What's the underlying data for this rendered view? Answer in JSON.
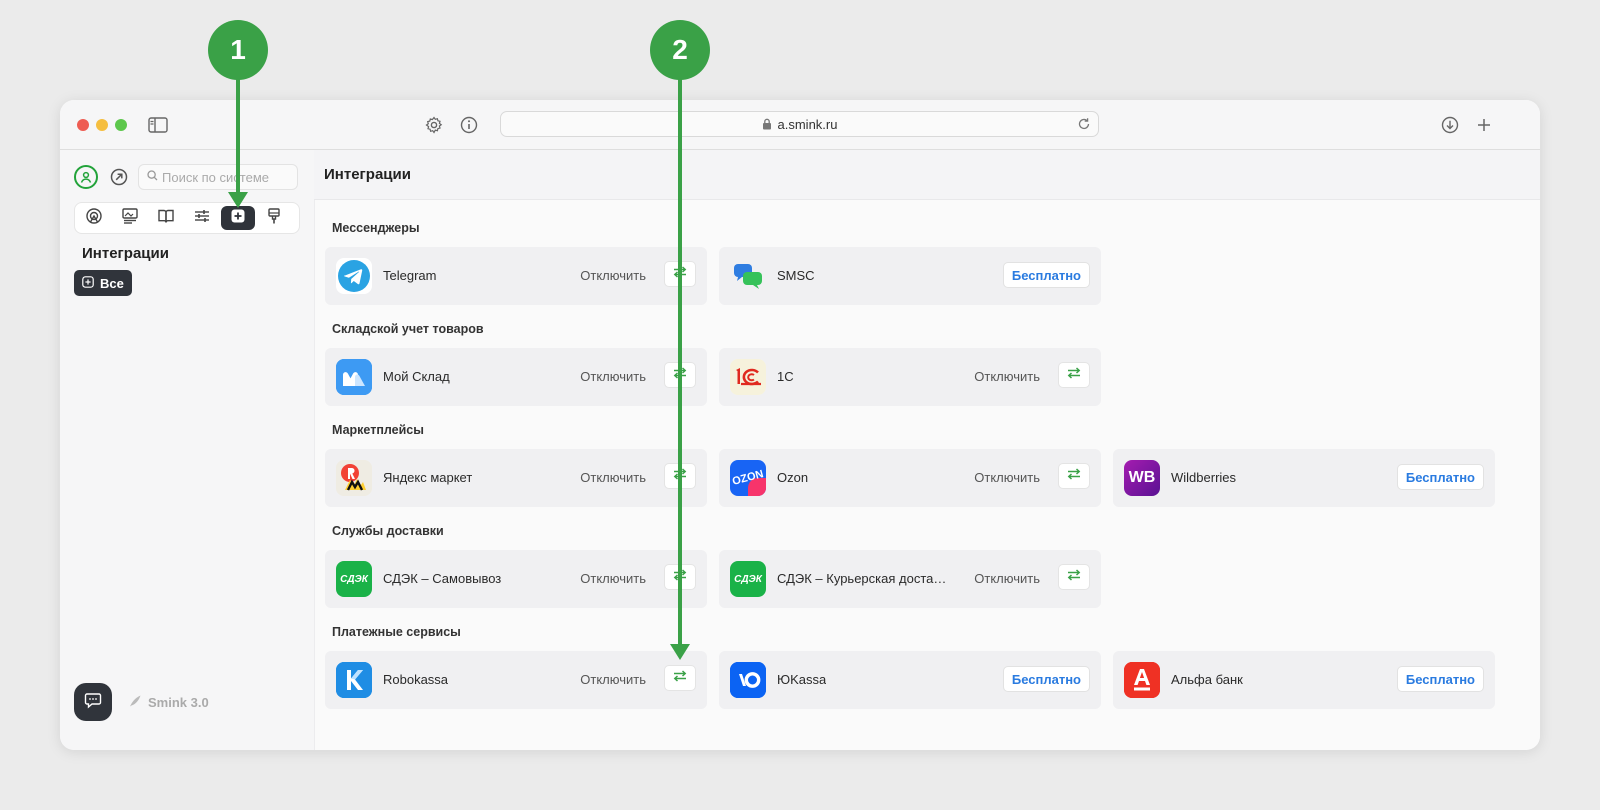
{
  "browser": {
    "url": "a.smink.ru"
  },
  "sidebar": {
    "search_placeholder": "Поиск по системе",
    "section_title": "Интеграции",
    "all_label": "Все",
    "version": "Smink 3.0"
  },
  "main": {
    "title": "Интеграции",
    "sections": [
      {
        "title": "Мессенджеры",
        "items": [
          {
            "name": "Telegram",
            "status": "Отключить",
            "action": "settings",
            "logo": "telegram-icon"
          },
          {
            "name": "SMSC",
            "action_label": "Бесплатно",
            "logo": "smsc-icon"
          }
        ]
      },
      {
        "title": "Складской учет товаров",
        "items": [
          {
            "name": "Мой Склад",
            "status": "Отключить",
            "action": "settings",
            "logo": "moysklad-icon"
          },
          {
            "name": "1С",
            "status": "Отключить",
            "action": "settings",
            "logo": "1c-icon"
          }
        ]
      },
      {
        "title": "Маркетплейсы",
        "items": [
          {
            "name": "Яндекс маркет",
            "status": "Отключить",
            "action": "settings",
            "logo": "yandex-market-icon"
          },
          {
            "name": "Ozon",
            "status": "Отключить",
            "action": "settings",
            "logo": "ozon-icon",
            "logo_text": "OZON"
          },
          {
            "name": "Wildberries",
            "action_label": "Бесплатно",
            "logo": "wildberries-icon",
            "logo_text": "WB"
          }
        ]
      },
      {
        "title": "Службы доставки",
        "items": [
          {
            "name": "СДЭК – Самовывоз",
            "status": "Отключить",
            "action": "settings",
            "logo": "cdek-icon",
            "logo_text": "СДЭК"
          },
          {
            "name": "СДЭК – Курьерская доставка",
            "status": "Отключить",
            "action": "settings",
            "logo": "cdek-icon",
            "logo_text": "СДЭК"
          }
        ]
      },
      {
        "title": "Платежные сервисы",
        "items": [
          {
            "name": "Robokassa",
            "status": "Отключить",
            "action": "settings",
            "logo": "robokassa-icon"
          },
          {
            "name": "ЮKassa",
            "action_label": "Бесплатно",
            "logo": "yookassa-icon"
          },
          {
            "name": "Альфа банк",
            "action_label": "Бесплатно",
            "logo": "alfa-bank-icon"
          }
        ]
      }
    ]
  },
  "annotations": {
    "marker1": "1",
    "marker2": "2"
  },
  "colors": {
    "accent_green": "#3aa147",
    "link_blue": "#2a7be0",
    "dark_button": "#30343b"
  }
}
